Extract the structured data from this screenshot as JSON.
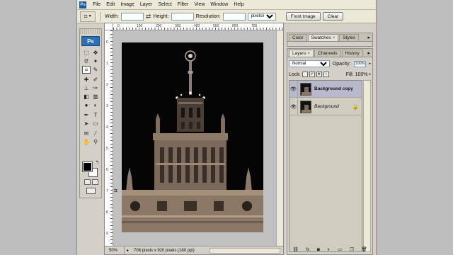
{
  "menubar": {
    "app_icon": "Ps",
    "items": [
      "File",
      "Edit",
      "Image",
      "Layer",
      "Select",
      "Filter",
      "View",
      "Window",
      "Help"
    ]
  },
  "options": {
    "tool_icon": "crop-icon",
    "width_label": "Width:",
    "width_value": "",
    "height_label": "Height:",
    "height_value": "",
    "resolution_label": "Resolution:",
    "resolution_value": "",
    "resolution_unit": "pixels/inch",
    "front_image_label": "Front Image",
    "clear_label": "Clear"
  },
  "toolbox": {
    "logo": "Ps"
  },
  "ruler": {
    "top_ticks": [
      "0",
      "100",
      "200",
      "300",
      "400",
      "500",
      "600",
      "700"
    ],
    "left_ticks": [
      "0",
      "1",
      "2",
      "3",
      "4",
      "5",
      "6",
      "7",
      "8",
      "9"
    ]
  },
  "document": {
    "zoom": "50%",
    "info": "706 pixels x 920 pixels (180 ppi)"
  },
  "panels": {
    "top_tabs": [
      "Color",
      "Swatches",
      "Styles"
    ],
    "layer_tabs": [
      "Layers",
      "Channels",
      "History"
    ],
    "blend_mode": "Normal",
    "opacity_label": "Opacity:",
    "opacity_value": "100%",
    "lock_label": "Lock:",
    "fill_label": "Fill:",
    "fill_value": "100%",
    "layers": [
      {
        "name": "Background copy",
        "selected": true
      },
      {
        "name": "Background",
        "selected": false
      }
    ]
  },
  "colors": {
    "foreground": "#000000",
    "background": "#ffffff",
    "canvas_bg": "#050505"
  }
}
